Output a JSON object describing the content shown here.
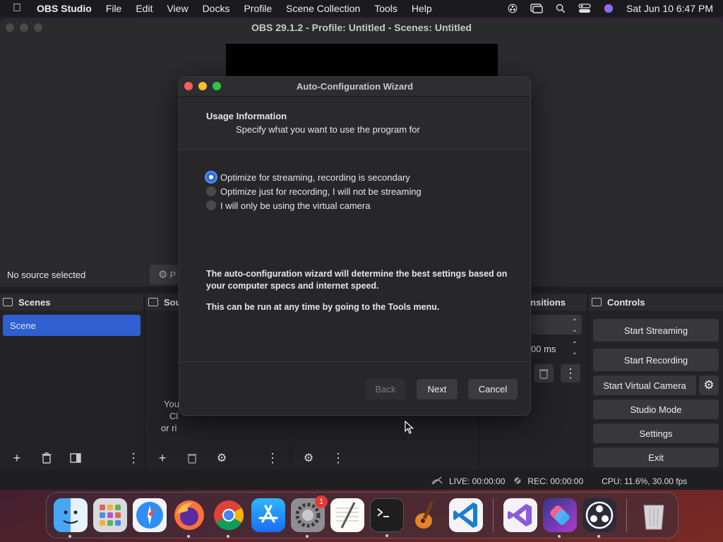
{
  "menubar": {
    "app_name": "OBS Studio",
    "items": [
      "File",
      "Edit",
      "View",
      "Docks",
      "Profile",
      "Scene Collection",
      "Tools",
      "Help"
    ],
    "clock": "Sat Jun 10  6:47 PM"
  },
  "obs": {
    "window_title": "OBS 29.1.2 - Profile: Untitled - Scenes: Untitled",
    "no_source": "No source selected",
    "properties_label": "P",
    "scenes_header": "Scenes",
    "scene_item": "Scene",
    "sources_header": "Sou",
    "sources_hint_1": "You",
    "sources_hint_2": "Cl",
    "sources_hint_3": "or ri",
    "transitions_header": "ansitions",
    "duration_value": "00 ms",
    "controls_header": "Controls",
    "controls": {
      "start_streaming": "Start Streaming",
      "start_recording": "Start Recording",
      "start_virtual_camera": "Start Virtual Camera",
      "studio_mode": "Studio Mode",
      "settings": "Settings",
      "exit": "Exit"
    },
    "status": {
      "live": "LIVE: 00:00:00",
      "rec": "REC: 00:00:00",
      "cpu": "CPU: 11.6%, 30.00 fps"
    }
  },
  "wizard": {
    "title": "Auto-Configuration Wizard",
    "section_title": "Usage Information",
    "section_subtitle": "Specify what you want to use the program for",
    "options": [
      {
        "label": "Optimize for streaming, recording is secondary",
        "checked": true
      },
      {
        "label": "Optimize just for recording, I will not be streaming",
        "checked": false
      },
      {
        "label": "I will only be using the virtual camera",
        "checked": false
      }
    ],
    "info_1": "The auto-configuration wizard will determine the best settings based on your computer specs and internet speed.",
    "info_2": "This can be run at any time by going to the Tools menu.",
    "buttons": {
      "back": "Back",
      "next": "Next",
      "cancel": "Cancel"
    }
  },
  "dock": {
    "apps": [
      "finder-icon",
      "launchpad-icon",
      "safari-icon",
      "firefox-icon",
      "chrome-icon",
      "app-store-icon",
      "system-settings-icon",
      "textedit-icon",
      "terminal-icon",
      "garageband-icon",
      "vscode-icon",
      "visual-studio-icon",
      "shortcuts-icon",
      "obs-icon",
      "trash-icon"
    ],
    "settings_badge": "1"
  }
}
